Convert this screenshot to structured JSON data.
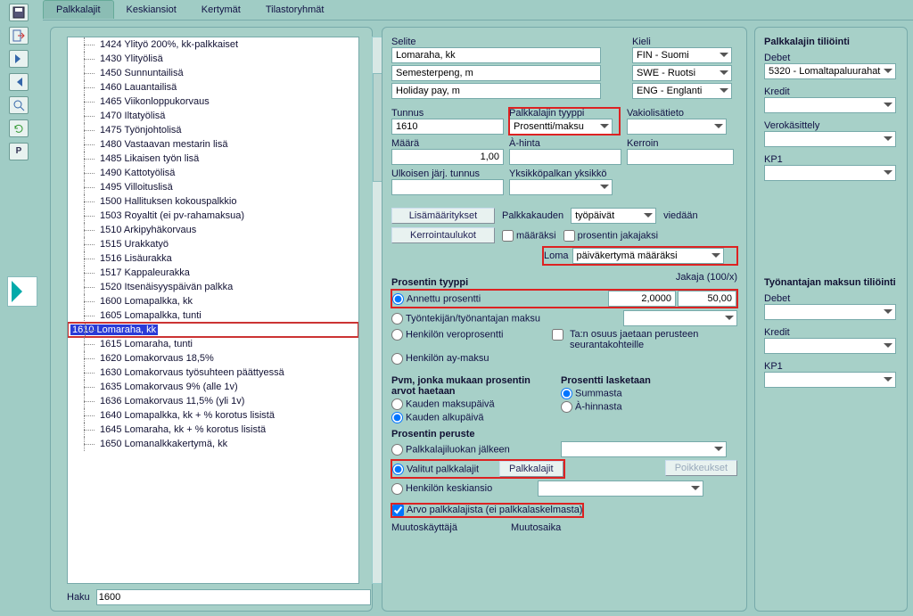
{
  "tabs": [
    "Palkkalajit",
    "Keskiansiot",
    "Kertymät",
    "Tilastoryhmät"
  ],
  "active_tab": 0,
  "list": [
    "1424 Ylityö 200%, kk-palkkaiset",
    "1430 Ylityölisä",
    "1450 Sunnuntailisä",
    "1460 Lauantailisä",
    "1465 Viikonloppukorvaus",
    "1470 Iltatyölisä",
    "1475 Työnjohtolisä",
    "1480 Vastaavan mestarin lisä",
    "1485 Likaisen työn lisä",
    "1490 Kattotyölisä",
    "1495 Villoituslisä",
    "1500 Hallituksen kokouspalkkio",
    "1503 Royaltit (ei pv-rahamaksua)",
    "1510 Arkipyhäkorvaus",
    "1515 Urakkatyö",
    "1516 Lisäurakka",
    "1517 Kappaleurakka",
    "1520 Itsenäisyyspäivän palkka",
    "1600 Lomapalkka, kk",
    "1605 Lomapalkka, tunti",
    "1610 Lomaraha, kk",
    "1615 Lomaraha, tunti",
    "1620 Lomakorvaus 18,5%",
    "1630 Lomakorvaus työsuhteen päättyessä",
    "1635 Lomakorvaus 9% (alle 1v)",
    "1636 Lomakorvaus 11,5% (yli 1v)",
    "1640 Lomapalkka, kk + % korotus lisistä",
    "1645 Lomaraha, kk + % korotus lisistä",
    "1650 Lomanalkkakertymä, kk"
  ],
  "selected_index": 20,
  "haku_label": "Haku",
  "haku_value": "1600",
  "selite": {
    "label": "Selite",
    "kieli_label": "Kieli",
    "rows": [
      {
        "text": "Lomaraha, kk",
        "kieli": "FIN - Suomi"
      },
      {
        "text": "Semesterpeng, m",
        "kieli": "SWE - Ruotsi"
      },
      {
        "text": "Holiday pay, m",
        "kieli": "ENG - Englanti"
      }
    ]
  },
  "tunnus": {
    "label": "Tunnus",
    "value": "1610"
  },
  "palkkalajin_tyyppi": {
    "label": "Palkkalajin tyyppi",
    "value": "Prosentti/maksu"
  },
  "vakiolisatieto": {
    "label": "Vakiolisätieto",
    "value": ""
  },
  "maara": {
    "label": "Määrä",
    "value": "1,00"
  },
  "ahinta": {
    "label": "À-hinta",
    "value": ""
  },
  "kerroin": {
    "label": "Kerroin",
    "value": ""
  },
  "ulk_tunnus": {
    "label": "Ulkoisen järj. tunnus",
    "value": ""
  },
  "yksikkopalkan": {
    "label": "Yksikköpalkan yksikkö",
    "value": ""
  },
  "lisamaaritykset_btn": "Lisämääritykset",
  "kerrointaulukot_btn": "Kerrointaulukot",
  "palkkakauden_label": "Palkkakauden",
  "palkkakauden_value": "työpäivät",
  "viedaan": "viedään",
  "maaraksi_chk": "määräksi",
  "prosentin_jakajaksi_chk": "prosentin jakajaksi",
  "loma_label": "Loma",
  "loma_value": "päiväkertymä määräksi",
  "prosentin_tyyppi_label": "Prosentin tyyppi",
  "jakaja_label": "Jakaja (100/x)",
  "pt": {
    "annettu": "Annettu prosentti",
    "tyontekijan": "Työntekijän/työnantajan maksu",
    "henkilon_vero": "Henkilön veroprosentti",
    "henkilon_ay": "Henkilön ay-maksu"
  },
  "prosentti_value": "2,0000",
  "jakaja_value": "50,00",
  "tan_osuus": "Ta:n osuus jaetaan perusteen seurantakohteille",
  "pvm_label": "Pvm, jonka mukaan prosentin arvot haetaan",
  "kauden_maksupaiva": "Kauden maksupäivä",
  "kauden_alkupaiva": "Kauden alkupäivä",
  "pros_lasketaan_label": "Prosentti lasketaan",
  "summasta": "Summasta",
  "ahinnasta": "À-hinnasta",
  "prosentin_peruste_label": "Prosentin peruste",
  "peruste": {
    "pljalkeen": "Palkkalajiluokan jälkeen",
    "valitut": "Valitut palkkalajit",
    "keskiansio": "Henkilön keskiansio"
  },
  "palkkalajit_btn": "Palkkalajit",
  "poikkeukset_btn": "Poikkeukset",
  "arvo_chk": "Arvo palkkalajista (ei palkkalaskelmasta)",
  "muutoskayttaja": "Muutoskäyttäjä",
  "muutosaika": "Muutosaika",
  "right": {
    "title1": "Palkkalajin tiliöinti",
    "debet": "Debet",
    "debet_val": "5320 - Lomaltapaluurahat",
    "kredit": "Kredit",
    "verokasittely": "Verokäsittely",
    "kp1": "KP1",
    "title2": "Työnantajan maksun tiliöinti"
  },
  "toolbar_icons": [
    "save-icon",
    "exit-icon",
    "forward-icon",
    "back-icon",
    "zoom-icon",
    "refresh-icon",
    "p-icon"
  ]
}
